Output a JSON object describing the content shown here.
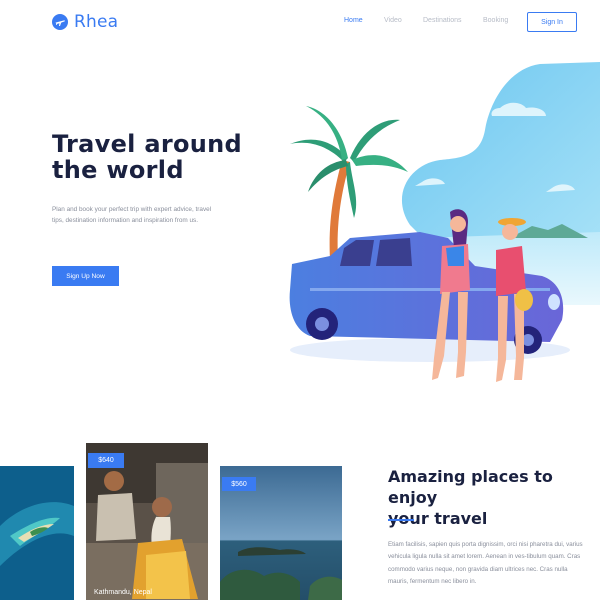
{
  "header": {
    "brand": "Rhea",
    "nav": [
      "Home",
      "Video",
      "Destinations",
      "Booking"
    ],
    "active_nav": "Home",
    "signin_label": "Sign In"
  },
  "hero": {
    "title_lines": [
      "Travel around",
      "the world"
    ],
    "description": "Plan and book your perfect trip with expert advice, travel tips, destination information and inspiration from us.",
    "signup_label": "Sign Up Now"
  },
  "cards": [
    {
      "price": "",
      "caption": ""
    },
    {
      "price": "$640",
      "caption": "Kathmandu, Nepal"
    },
    {
      "price": "$560",
      "caption": ""
    }
  ],
  "feature": {
    "title_lines": [
      "Amazing places to enjoy",
      "your travel"
    ],
    "text": "Etiam facilisis, sapien quis porta dignissim, orci nisi pharetra dui, varius vehicula ligula nulla sit amet lorem. Aenean in ves-tibulum quam. Cras commodo varius neque, non gravida diam ultrices nec. Cras nulla mauris, fermentum nec libero in."
  },
  "colors": {
    "accent": "#3a7bf2",
    "title": "#1a2140",
    "muted": "#8a8f9c",
    "sky": "#8dd3f4"
  },
  "icons": {
    "logo": "airplane-icon"
  }
}
